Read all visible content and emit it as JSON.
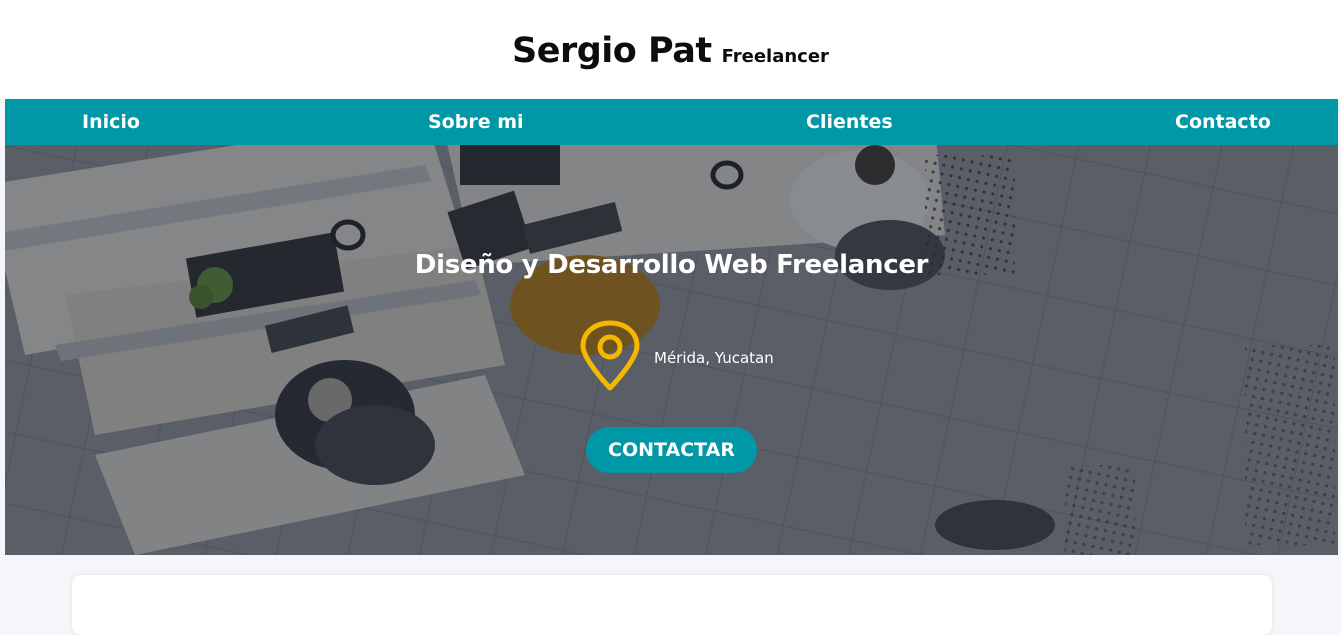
{
  "header": {
    "name": "Sergio Pat",
    "tagline": "Freelancer"
  },
  "nav": {
    "items": [
      {
        "label": "Inicio"
      },
      {
        "label": "Sobre mi"
      },
      {
        "label": "Clientes"
      },
      {
        "label": "Contacto"
      }
    ]
  },
  "hero": {
    "title": "Diseño y Desarrollo Web Freelancer",
    "location": "Mérida, Yucatan",
    "location_icon": "map-pin-icon",
    "cta_label": "CONTACTAR"
  },
  "colors": {
    "accent": "#0097a7",
    "pin": "#f5b800",
    "header_bg": "#ffffff",
    "page_bg": "#f4f6f9"
  }
}
